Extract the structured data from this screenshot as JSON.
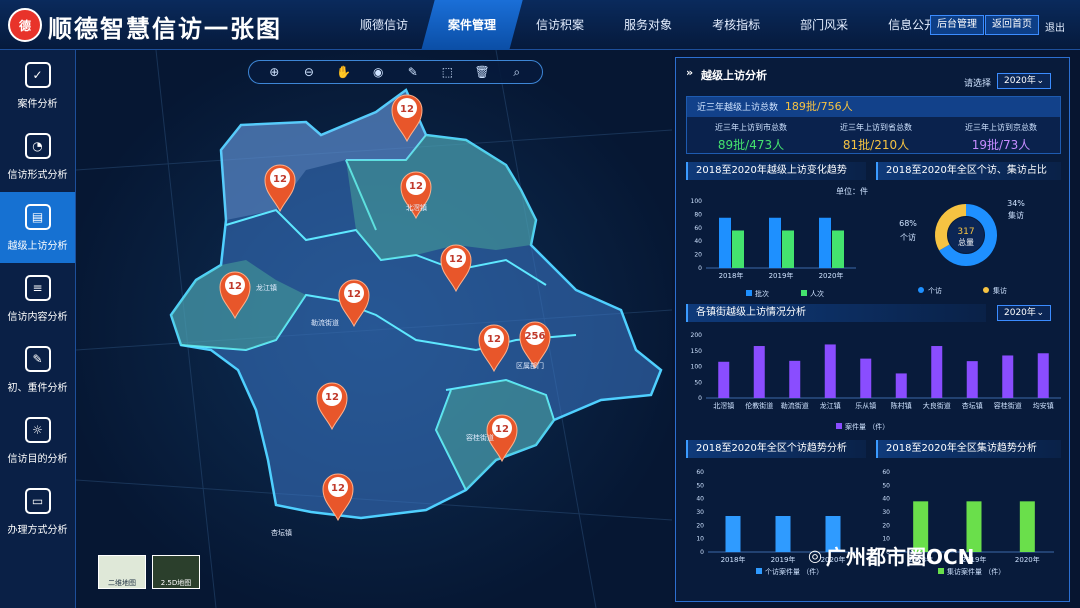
{
  "header": {
    "logo": "德",
    "title": "顺德智慧信访一张图",
    "nav": [
      "顺德信访",
      "案件管理",
      "信访积案",
      "服务对象",
      "考核指标",
      "部门风采",
      "信息公开"
    ],
    "active": 1,
    "admin": "后台管理",
    "home": "返回首页",
    "exit": "退出"
  },
  "sidebar": {
    "items": [
      {
        "label": "案件分析",
        "icon": "chart-icon"
      },
      {
        "label": "信访形式分析",
        "icon": "pie-icon"
      },
      {
        "label": "越级上访分析",
        "icon": "document-icon"
      },
      {
        "label": "信访内容分析",
        "icon": "list-icon"
      },
      {
        "label": "初、重件分析",
        "icon": "analysis-icon"
      },
      {
        "label": "信访目的分析",
        "icon": "bulb-icon"
      },
      {
        "label": "办理方式分析",
        "icon": "monitor-icon"
      }
    ],
    "active": 2
  },
  "map": {
    "pins": [
      "12",
      "12",
      "12",
      "12",
      "12",
      "12",
      "12",
      "256",
      "12",
      "12",
      "12"
    ],
    "thumb1": "二维地图",
    "thumb2": "2.5D地图",
    "places": [
      "北滘镇",
      "龙江镇",
      "勒流街道",
      "容桂街道",
      "区属部门",
      "杏坛镇"
    ]
  },
  "panel": {
    "title": "越级上访分析",
    "select_label": "请选择",
    "year": "2020年",
    "summary": {
      "label": "近三年越级上访总数",
      "value": "189批/756人",
      "sub": [
        {
          "label": "近三年上访到市总数",
          "value": "89批/473人"
        },
        {
          "label": "近三年上访到省总数",
          "value": "81批/210人"
        },
        {
          "label": "近三年上访到京总数",
          "value": "19批/73人"
        }
      ]
    },
    "sec1": "2018至2020年越级上访变化趋势",
    "sec2": "2018至2020年全区个访、集访占比",
    "sec3": "各镇街越级上访情况分析",
    "sec4": "2018至2020年全区个访趋势分析",
    "sec5": "2018至2020年全区集访趋势分析",
    "unit": "单位：件",
    "sec3_year": "2020年"
  },
  "chart_data": [
    {
      "type": "bar",
      "title": "2018至2020年越级上访变化趋势",
      "categories": [
        "2018年",
        "2019年",
        "2020年"
      ],
      "series": [
        {
          "name": "批次",
          "values": [
            75,
            75,
            75
          ],
          "color": "#1e90ff"
        },
        {
          "name": "人次",
          "values": [
            56,
            56,
            56
          ],
          "color": "#44e36e"
        }
      ],
      "ylim": [
        0,
        100
      ],
      "yticks": [
        0,
        20,
        40,
        60,
        80,
        100
      ]
    },
    {
      "type": "pie",
      "title": "2018至2020年全区个访、集访占比",
      "center_value": "317",
      "center_label": "总量",
      "slices": [
        {
          "name": "个访",
          "value": 68,
          "pct": "68%",
          "color": "#1e90ff"
        },
        {
          "name": "集访",
          "value": 34,
          "pct": "34%",
          "color": "#f6c342"
        }
      ]
    },
    {
      "type": "bar",
      "title": "各镇街越级上访情况分析",
      "categories": [
        "北滘镇",
        "伦教街道",
        "勒流街道",
        "龙江镇",
        "乐从镇",
        "陈村镇",
        "大良街道",
        "杏坛镇",
        "容桂街道",
        "均安镇"
      ],
      "series": [
        {
          "name": "案件量 （件）",
          "values": [
            115,
            165,
            118,
            170,
            125,
            78,
            165,
            117,
            135,
            142
          ],
          "color": "#8a4dff"
        }
      ],
      "ylim": [
        0,
        200
      ],
      "yticks": [
        0,
        50,
        100,
        150,
        200
      ]
    },
    {
      "type": "bar",
      "title": "2018至2020年全区个访趋势分析",
      "categories": [
        "2018年",
        "2019年",
        "2020年"
      ],
      "series": [
        {
          "name": "个访案件量 （件）",
          "values": [
            27,
            27,
            27
          ],
          "color": "#2f9bff"
        }
      ],
      "ylim": [
        0,
        60
      ],
      "yticks": [
        0,
        10,
        20,
        30,
        40,
        50,
        60
      ]
    },
    {
      "type": "bar",
      "title": "2018至2020年全区集访趋势分析",
      "categories": [
        "2018年",
        "2019年",
        "2020年"
      ],
      "series": [
        {
          "name": "集访案件量 （件）",
          "values": [
            38,
            38,
            38
          ],
          "color": "#6adf4b"
        }
      ],
      "ylim": [
        0,
        60
      ],
      "yticks": [
        0,
        10,
        20,
        30,
        40,
        50,
        60
      ]
    }
  ],
  "watermark": "广州都市圈OCN"
}
